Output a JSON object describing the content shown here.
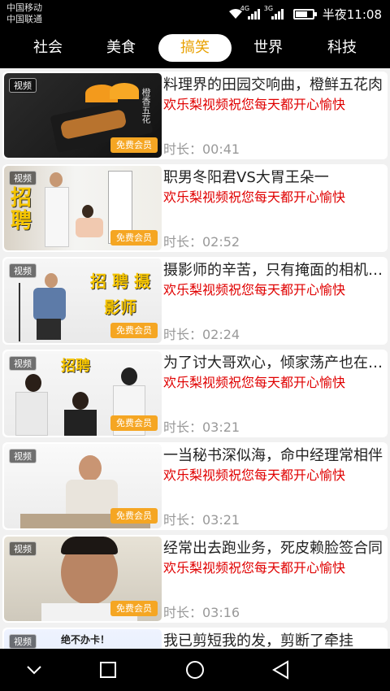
{
  "status": {
    "carrier1": "中国移动",
    "carrier2": "中国联通",
    "net1": "4G",
    "net2": "3G",
    "time": "半夜11:08"
  },
  "tabs": [
    {
      "label": "社会"
    },
    {
      "label": "美食"
    },
    {
      "label": "搞笑",
      "active": true
    },
    {
      "label": "世界"
    },
    {
      "label": "科技"
    }
  ],
  "videos": [
    {
      "tag": "视频",
      "vip": "免费会员",
      "title": "料理界的田园交响曲，橙鲜五花肉",
      "subtitle": "欢乐梨视频祝您每天都开心愉快",
      "duration": "时长：00:41",
      "thumb_text": "橙香五花"
    },
    {
      "tag": "视频",
      "vip": "免费会员",
      "title": "职男冬阳君VS大胃王朵一",
      "subtitle": "欢乐梨视频祝您每天都开心愉快",
      "duration": "时长：02:52",
      "thumb_text": "招聘"
    },
    {
      "tag": "视频",
      "vip": "免费会员",
      "title": "摄影师的辛苦，只有掩面的相机知道",
      "subtitle": "欢乐梨视频祝您每天都开心愉快",
      "duration": "时长：02:24",
      "thumb_text": "招 聘 摄影师"
    },
    {
      "tag": "视频",
      "vip": "免费会员",
      "title": "为了讨大哥欢心，倾家荡产也在所不惜",
      "subtitle": "欢乐梨视频祝您每天都开心愉快",
      "duration": "时长：03:21",
      "thumb_text": "招聘"
    },
    {
      "tag": "视频",
      "vip": "免费会员",
      "title": "一当秘书深似海，命中经理常相伴",
      "subtitle": "欢乐梨视频祝您每天都开心愉快",
      "duration": "时长：03:21",
      "thumb_text": ""
    },
    {
      "tag": "视频",
      "vip": "免费会员",
      "title": "经常出去跑业务，死皮赖脸签合同",
      "subtitle": "欢乐梨视频祝您每天都开心愉快",
      "duration": "时长：03:16",
      "thumb_text": ""
    },
    {
      "tag": "视频",
      "vip": "",
      "title": "我已剪短我的发，剪断了牵挂",
      "subtitle": "",
      "duration": "",
      "thumb_text": "绝不办卡！"
    }
  ],
  "colors": {
    "accent": "#e8a000",
    "subtitle": "#e00000",
    "vip_badge": "#f5a623"
  },
  "nav": {
    "back_icon": "chevron-down-icon",
    "home_icon": "circle-home-icon",
    "recent_icon": "square-recent-icon",
    "return_icon": "triangle-back-icon"
  }
}
